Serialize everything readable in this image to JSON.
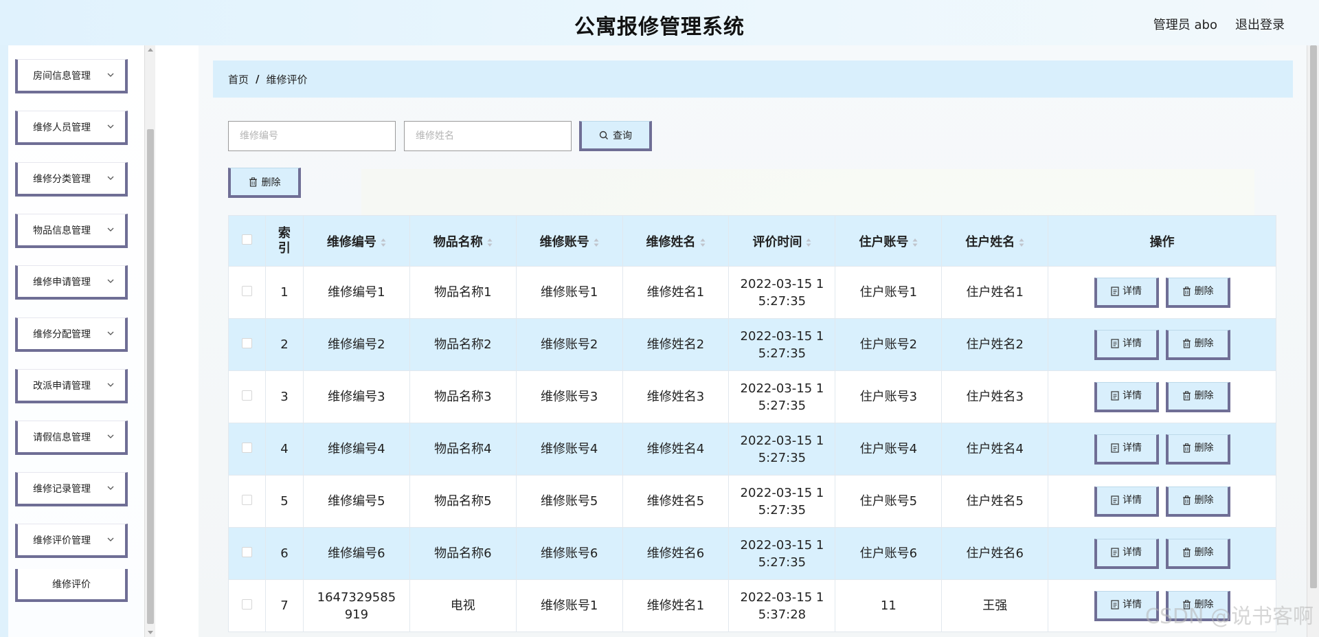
{
  "header": {
    "title": "公寓报修管理系统",
    "user": "管理员 abo",
    "logout": "退出登录"
  },
  "sidebar": {
    "items": [
      {
        "label": "房间信息管理"
      },
      {
        "label": "维修人员管理"
      },
      {
        "label": "维修分类管理"
      },
      {
        "label": "物品信息管理"
      },
      {
        "label": "维修申请管理"
      },
      {
        "label": "维修分配管理"
      },
      {
        "label": "改派申请管理"
      },
      {
        "label": "请假信息管理"
      },
      {
        "label": "维修记录管理"
      },
      {
        "label": "维修评价管理"
      }
    ],
    "sub_item": "维修评价"
  },
  "breadcrumb": {
    "home": "首页",
    "separator": "/",
    "current": "维修评价"
  },
  "search": {
    "code_placeholder": "维修编号",
    "name_placeholder": "维修姓名",
    "query_label": "查询",
    "delete_label": "删除"
  },
  "table": {
    "headers": [
      "索引",
      "维修编号",
      "物品名称",
      "维修账号",
      "维修姓名",
      "评价时间",
      "住户账号",
      "住户姓名",
      "操作"
    ],
    "rows": [
      {
        "index": "1",
        "code": "维修编号1",
        "item": "物品名称1",
        "account": "维修账号1",
        "name": "维修姓名1",
        "time": "2022-03-15 15:27:35",
        "resident_account": "住户账号1",
        "resident_name": "住户姓名1"
      },
      {
        "index": "2",
        "code": "维修编号2",
        "item": "物品名称2",
        "account": "维修账号2",
        "name": "维修姓名2",
        "time": "2022-03-15 15:27:35",
        "resident_account": "住户账号2",
        "resident_name": "住户姓名2"
      },
      {
        "index": "3",
        "code": "维修编号3",
        "item": "物品名称3",
        "account": "维修账号3",
        "name": "维修姓名3",
        "time": "2022-03-15 15:27:35",
        "resident_account": "住户账号3",
        "resident_name": "住户姓名3"
      },
      {
        "index": "4",
        "code": "维修编号4",
        "item": "物品名称4",
        "account": "维修账号4",
        "name": "维修姓名4",
        "time": "2022-03-15 15:27:35",
        "resident_account": "住户账号4",
        "resident_name": "住户姓名4"
      },
      {
        "index": "5",
        "code": "维修编号5",
        "item": "物品名称5",
        "account": "维修账号5",
        "name": "维修姓名5",
        "time": "2022-03-15 15:27:35",
        "resident_account": "住户账号5",
        "resident_name": "住户姓名5"
      },
      {
        "index": "6",
        "code": "维修编号6",
        "item": "物品名称6",
        "account": "维修账号6",
        "name": "维修姓名6",
        "time": "2022-03-15 15:27:35",
        "resident_account": "住户账号6",
        "resident_name": "住户姓名6"
      },
      {
        "index": "7",
        "code": "1647329585919",
        "item": "电视",
        "account": "维修账号1",
        "name": "维修姓名1",
        "time": "2022-03-15 15:37:28",
        "resident_account": "11",
        "resident_name": "王强"
      }
    ],
    "detail_label": "详情",
    "delete_label": "删除"
  },
  "watermark": "CSDN @说书客啊",
  "colors": {
    "accent_border": "#6f6e95",
    "row_highlight": "#d9f0fd",
    "button_bg": "#d9effc"
  }
}
